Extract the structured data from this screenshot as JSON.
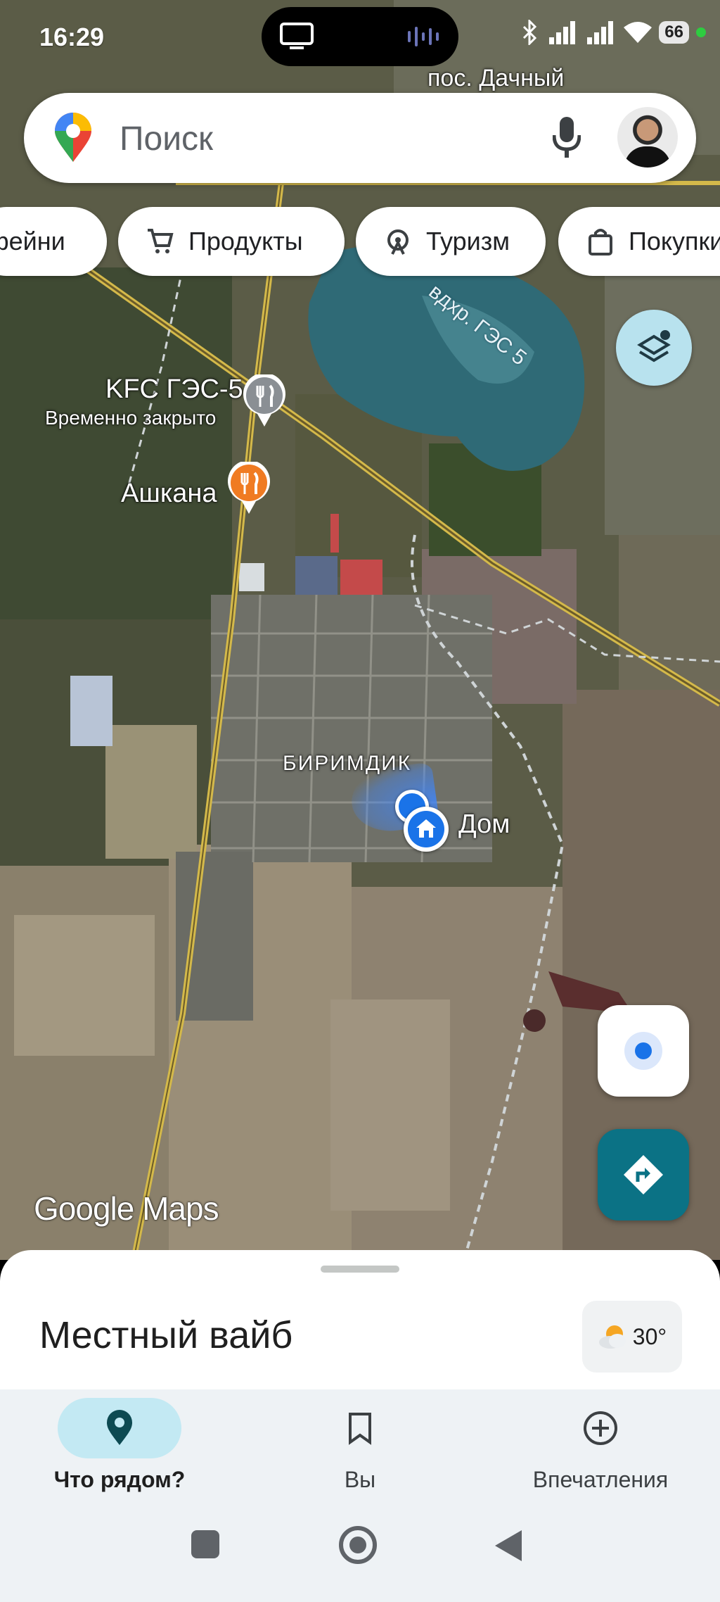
{
  "status_bar": {
    "time": "16:29",
    "battery": "66"
  },
  "search": {
    "placeholder": "Поиск"
  },
  "chips": [
    {
      "label": "Кафейни",
      "icon": "cafe-icon"
    },
    {
      "label": "Продукты",
      "icon": "cart-icon"
    },
    {
      "label": "Туризм",
      "icon": "ferris-wheel-icon"
    },
    {
      "label": "Покупки",
      "icon": "shopping-bag-icon"
    }
  ],
  "map": {
    "settlement_label": "пос. Дачный",
    "water_label": "вдхр. ГЭС 5",
    "places": [
      {
        "name": "KFC ГЭС-5",
        "status": "Временно закрыто",
        "icon": "restaurant-icon",
        "color": "#8a8f94"
      },
      {
        "name": "Ашкана",
        "icon": "restaurant-icon",
        "color": "#f07b22"
      }
    ],
    "village_label": "БИРИМДИК",
    "home_label": "Дом",
    "logo": "Google Maps"
  },
  "sheet": {
    "title": "Местный вайб",
    "weather": "30°"
  },
  "bottom_nav": [
    {
      "label": "Что рядом?",
      "icon": "location-pin-icon",
      "active": true
    },
    {
      "label": "Вы",
      "icon": "bookmark-icon",
      "active": false
    },
    {
      "label": "Впечатления",
      "icon": "add-circle-icon",
      "active": false
    }
  ],
  "colors": {
    "accent": "#1a73e8",
    "directions": "#0b7285",
    "nav_active": "#c3e9f3"
  }
}
